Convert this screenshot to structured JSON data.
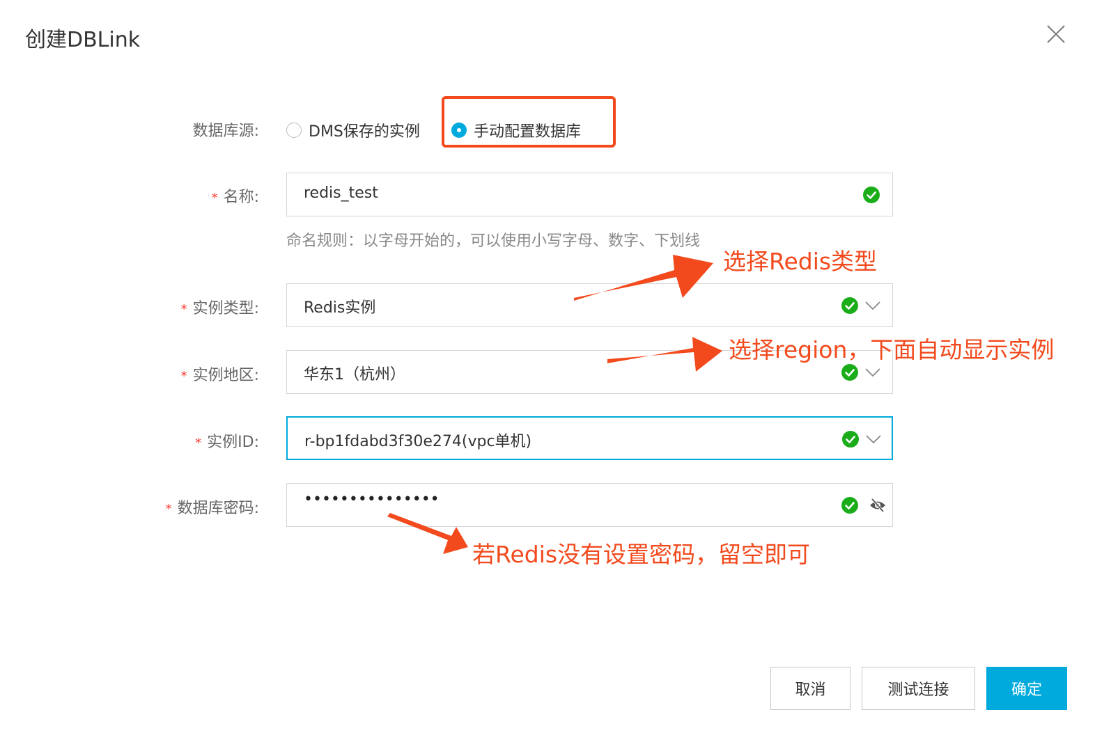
{
  "dialog": {
    "title": "创建DBLink"
  },
  "form": {
    "db_source": {
      "label": "数据库源:",
      "options": [
        {
          "label": "DMS保存的实例",
          "selected": false
        },
        {
          "label": "手动配置数据库",
          "selected": true
        }
      ]
    },
    "name": {
      "label": "名称:",
      "required": true,
      "value": "redis_test",
      "hint": "命名规则：以字母开始的，可以使用小写字母、数字、下划线"
    },
    "instance_type": {
      "label": "实例类型:",
      "required": true,
      "value": "Redis实例"
    },
    "instance_region": {
      "label": "实例地区:",
      "required": true,
      "value": "华东1（杭州）"
    },
    "instance_id": {
      "label": "实例ID:",
      "required": true,
      "value": "r-bp1fdabd3f30e274(vpc单机)"
    },
    "db_password": {
      "label": "数据库密码:",
      "required": true,
      "value": "•••••••••••••••"
    }
  },
  "annotations": {
    "type": "选择Redis类型",
    "region": "选择region，下面自动显示实例",
    "password": "若Redis没有设置密码，留空即可"
  },
  "footer": {
    "cancel_label": "取消",
    "test_label": "测试连接",
    "confirm_label": "确定"
  },
  "colors": {
    "accent": "#00aadd",
    "annotation": "#f24a1d",
    "success": "#1aad19",
    "required": "#ff3b30"
  },
  "icons": {
    "close": "close-icon",
    "check": "check-circle-icon",
    "chevron": "chevron-down-icon",
    "eye": "eye-off-icon"
  }
}
